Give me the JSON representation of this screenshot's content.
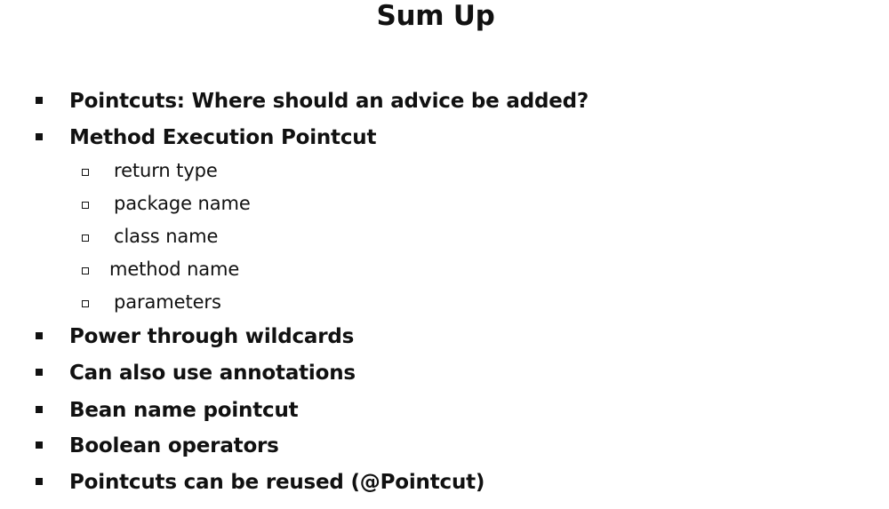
{
  "slide": {
    "title": "Sum Up",
    "items": [
      {
        "level": 1,
        "text": "Pointcuts: Where should an advice be added?"
      },
      {
        "level": 1,
        "text": "Method Execution Pointcut"
      },
      {
        "level": 2,
        "text": "return type"
      },
      {
        "level": 2,
        "text": "package name"
      },
      {
        "level": 2,
        "text": "class name"
      },
      {
        "level": 2,
        "text": "method name"
      },
      {
        "level": 2,
        "text": "parameters"
      },
      {
        "level": 1,
        "text": "Power through wildcards"
      },
      {
        "level": 1,
        "text": "Can also use annotations"
      },
      {
        "level": 1,
        "text": "Bean name pointcut"
      },
      {
        "level": 1,
        "text": "Boolean operators"
      },
      {
        "level": 1,
        "text": "Pointcuts can be reused (@Pointcut)"
      }
    ]
  }
}
